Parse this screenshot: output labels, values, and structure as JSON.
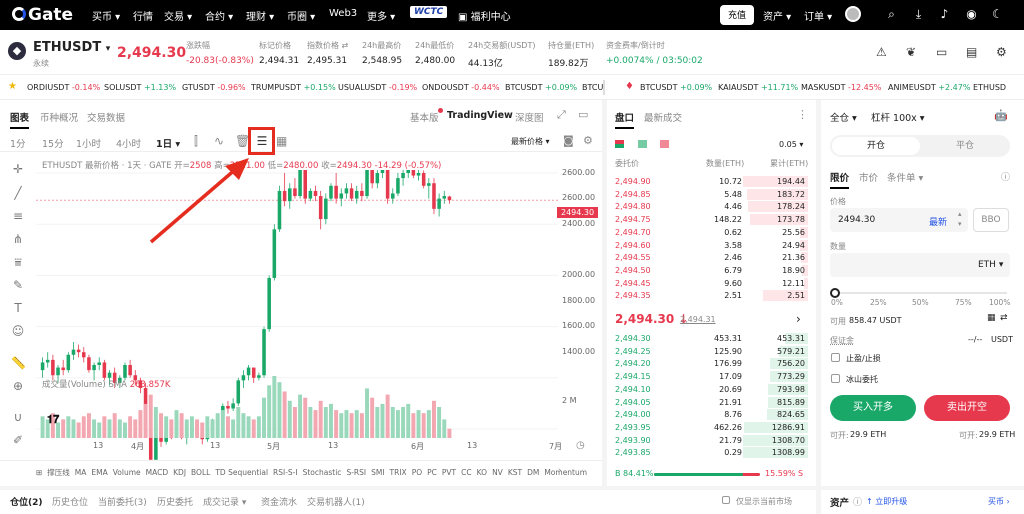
{
  "nav": {
    "logo": "Gate",
    "items": [
      "买币 ▾",
      "行情",
      "交易 ▾",
      "合约 ▾",
      "理财 ▾",
      "币圈 ▾",
      "Web3",
      "更多 ▾"
    ],
    "wctc": "WCTC",
    "welfare": "福利中心",
    "deposit": "充值",
    "assets": "资产 ▾",
    "orders": "订单 ▾"
  },
  "header": {
    "symbol": "ETHUSDT",
    "symbol_caret": "▾",
    "subtitle": "永续",
    "price": "2,494.30",
    "stats": [
      {
        "label": "涨跌幅",
        "value": "-20.83(-0.83%)",
        "color": "red"
      },
      {
        "label": "标记价格",
        "value": "2,494.31",
        "color": ""
      },
      {
        "label": "指数价格 ⇄",
        "value": "2,495.31",
        "color": ""
      },
      {
        "label": "24h最高价",
        "value": "2,548.95",
        "color": ""
      },
      {
        "label": "24h最低价",
        "value": "2,480.00",
        "color": ""
      },
      {
        "label": "24h交易额(USDT)",
        "value": "44.13亿",
        "color": ""
      },
      {
        "label": "持仓量(ETH)",
        "value": "189.82万",
        "color": ""
      },
      {
        "label": "资金费率/倒计时",
        "value": "+0.0074% / 03:50:02",
        "color": "green"
      }
    ]
  },
  "ticker": [
    {
      "sym": "ORDIUSDT",
      "chg": "-0.14%",
      "c": "red"
    },
    {
      "sym": "SOLUSDT",
      "chg": "+1.13%",
      "c": "green"
    },
    {
      "sym": "GTUSDT",
      "chg": "-0.96%",
      "c": "red"
    },
    {
      "sym": "TRUMPUSDT",
      "chg": "+0.15%",
      "c": "green"
    },
    {
      "sym": "USUALUSDT",
      "chg": "-0.19%",
      "c": "red"
    },
    {
      "sym": "ONDOUSDT",
      "chg": "-0.44%",
      "c": "red"
    },
    {
      "sym": "BTCUSDT",
      "chg": "+0.09%",
      "c": "green"
    },
    {
      "sym": "BTCU",
      "chg": "",
      "c": ""
    },
    {
      "sym": "BTCUSDT",
      "chg": "+0.09%",
      "c": "green"
    },
    {
      "sym": "KAIAUSDT",
      "chg": "+11.71%",
      "c": "green"
    },
    {
      "sym": "MASKUSDT",
      "chg": "-12.45%",
      "c": "red"
    },
    {
      "sym": "ANIMEUSDT",
      "chg": "+2.47%",
      "c": "green"
    },
    {
      "sym": "ETHUSD",
      "chg": "",
      "c": ""
    }
  ],
  "chart_tabs": {
    "chart": "图表",
    "overview": "币种概况",
    "trades": "交易数据",
    "basic": "基本版",
    "tv": "TradingView",
    "depth": "深度图"
  },
  "intervals": [
    "1分",
    "15分",
    "1小时",
    "4小时",
    "1日 ▾"
  ],
  "latest_price": "最新价格 ▾",
  "legend": {
    "title": "ETHUSDT 最新价格 · 1天 · GATE",
    "open_l": "开=",
    "open": "2508",
    "high_l": "高=",
    "high": "2511.00",
    "low_l": "低=",
    "low": "2480.00",
    "close_l": "收=",
    "close": "2494.30",
    "chg": "-14.29 (-0.57%)"
  },
  "volume_label": "成交量(Volume) SMA",
  "volume_value": "263.857K",
  "price_tag": "2494.30",
  "chart_data": {
    "type": "candlestick",
    "yticks": [
      "2600.00",
      "2400.00",
      "2200.00",
      "2000.00",
      "1800.00",
      "1600.00",
      "1400.00"
    ],
    "xticks": [
      "13",
      "4月",
      "13",
      "5月",
      "13",
      "6月",
      "13",
      "7月"
    ],
    "vol_tick": "2 M",
    "candles": [
      [
        1830,
        1880,
        1800,
        1860
      ],
      [
        1860,
        1900,
        1840,
        1870
      ],
      [
        1870,
        1890,
        1790,
        1810
      ],
      [
        1810,
        1850,
        1780,
        1840
      ],
      [
        1840,
        1870,
        1810,
        1830
      ],
      [
        1830,
        1900,
        1820,
        1890
      ],
      [
        1890,
        1940,
        1870,
        1910
      ],
      [
        1910,
        1930,
        1880,
        1900
      ],
      [
        1900,
        1920,
        1860,
        1880
      ],
      [
        1880,
        1890,
        1820,
        1830
      ],
      [
        1830,
        1860,
        1790,
        1850
      ],
      [
        1850,
        1880,
        1830,
        1860
      ],
      [
        1860,
        1870,
        1790,
        1800
      ],
      [
        1800,
        1830,
        1770,
        1820
      ],
      [
        1820,
        1840,
        1760,
        1780
      ],
      [
        1780,
        1810,
        1760,
        1800
      ],
      [
        1800,
        1860,
        1790,
        1850
      ],
      [
        1850,
        1870,
        1800,
        1810
      ],
      [
        1810,
        1830,
        1770,
        1790
      ],
      [
        1790,
        1800,
        1740,
        1760
      ],
      [
        1760,
        1780,
        1580,
        1600
      ],
      [
        1600,
        1620,
        1440,
        1480
      ],
      [
        1480,
        1580,
        1470,
        1570
      ],
      [
        1570,
        1600,
        1530,
        1550
      ],
      [
        1550,
        1600,
        1540,
        1590
      ],
      [
        1590,
        1620,
        1560,
        1580
      ],
      [
        1580,
        1660,
        1570,
        1640
      ],
      [
        1640,
        1650,
        1560,
        1570
      ],
      [
        1570,
        1600,
        1540,
        1590
      ],
      [
        1590,
        1630,
        1570,
        1610
      ],
      [
        1610,
        1630,
        1570,
        1580
      ],
      [
        1580,
        1600,
        1540,
        1560
      ],
      [
        1560,
        1610,
        1550,
        1600
      ],
      [
        1600,
        1640,
        1580,
        1620
      ],
      [
        1620,
        1650,
        1600,
        1640
      ],
      [
        1640,
        1700,
        1630,
        1690
      ],
      [
        1690,
        1710,
        1660,
        1680
      ],
      [
        1680,
        1720,
        1670,
        1700
      ],
      [
        1700,
        1800,
        1690,
        1790
      ],
      [
        1790,
        1830,
        1760,
        1810
      ],
      [
        1810,
        1850,
        1790,
        1840
      ],
      [
        1840,
        1840,
        1780,
        1800
      ],
      [
        1800,
        1820,
        1790,
        1810
      ],
      [
        1810,
        2000,
        1800,
        1990
      ],
      [
        1990,
        2200,
        1980,
        2190
      ],
      [
        2190,
        2400,
        2180,
        2380
      ],
      [
        2380,
        2550,
        2370,
        2530
      ],
      [
        2530,
        2600,
        2470,
        2490
      ],
      [
        2490,
        2560,
        2460,
        2540
      ],
      [
        2540,
        2580,
        2500,
        2510
      ],
      [
        2510,
        2640,
        2500,
        2620
      ],
      [
        2620,
        2640,
        2480,
        2500
      ],
      [
        2500,
        2540,
        2490,
        2530
      ],
      [
        2530,
        2550,
        2490,
        2510
      ],
      [
        2510,
        2530,
        2380,
        2420
      ],
      [
        2420,
        2520,
        2400,
        2500
      ],
      [
        2500,
        2560,
        2490,
        2550
      ],
      [
        2550,
        2600,
        2480,
        2500
      ],
      [
        2500,
        2540,
        2470,
        2520
      ],
      [
        2520,
        2560,
        2500,
        2540
      ],
      [
        2540,
        2560,
        2490,
        2500
      ],
      [
        2500,
        2550,
        2480,
        2530
      ],
      [
        2530,
        2560,
        2490,
        2510
      ],
      [
        2510,
        2700,
        2500,
        2680
      ],
      [
        2680,
        2700,
        2540,
        2560
      ],
      [
        2560,
        2620,
        2540,
        2600
      ],
      [
        2600,
        2660,
        2580,
        2640
      ],
      [
        2640,
        2680,
        2480,
        2500
      ],
      [
        2500,
        2540,
        2480,
        2520
      ],
      [
        2520,
        2600,
        2510,
        2580
      ],
      [
        2580,
        2620,
        2550,
        2600
      ],
      [
        2600,
        2650,
        2580,
        2630
      ],
      [
        2630,
        2640,
        2580,
        2590
      ],
      [
        2590,
        2620,
        2570,
        2600
      ],
      [
        2600,
        2610,
        2540,
        2550
      ],
      [
        2550,
        2580,
        2500,
        2560
      ],
      [
        2560,
        2580,
        2440,
        2460
      ],
      [
        2460,
        2520,
        2430,
        2500
      ],
      [
        2500,
        2530,
        2480,
        2510
      ],
      [
        2508,
        2511,
        2480,
        2494
      ]
    ],
    "volumes": [
      0.7,
      0.6,
      0.8,
      0.5,
      0.6,
      0.7,
      0.6,
      0.5,
      0.7,
      0.8,
      0.6,
      0.5,
      0.7,
      0.6,
      0.8,
      0.6,
      0.5,
      0.7,
      0.6,
      0.9,
      1.1,
      1.4,
      1.0,
      0.8,
      0.7,
      0.6,
      0.9,
      0.8,
      0.6,
      0.7,
      0.6,
      0.5,
      0.7,
      0.6,
      0.8,
      0.9,
      0.7,
      0.6,
      1.0,
      0.8,
      0.7,
      0.6,
      0.7,
      1.3,
      1.7,
      2.0,
      1.8,
      1.5,
      1.2,
      1.0,
      1.4,
      1.3,
      1.0,
      0.9,
      1.2,
      1.0,
      1.1,
      0.9,
      0.8,
      0.9,
      0.8,
      0.9,
      0.8,
      1.6,
      1.3,
      1.0,
      1.1,
      1.4,
      1.0,
      0.9,
      1.0,
      1.1,
      0.8,
      0.9,
      0.8,
      0.9,
      1.2,
      1.0,
      0.6,
      0.3
    ]
  },
  "indicators": [
    "撑压线",
    "MA",
    "EMA",
    "Volume",
    "MACD",
    "KDJ",
    "BOLL",
    "TD Sequential",
    "RSI-S-I",
    "Stochastic",
    "S-RSI",
    "SMI",
    "TRIX",
    "PO",
    "PC",
    "PVT",
    "CC",
    "KO",
    "NV",
    "KST",
    "DM",
    "Momentum"
  ],
  "orderbook": {
    "tab1": "盘口",
    "tab2": "最新成交",
    "step": "0.05 ▾",
    "col_price": "委托价",
    "col_qty": "数量(ETH)",
    "col_total": "累计(ETH)",
    "asks": [
      [
        "2,494.90",
        "10.72",
        "194.44"
      ],
      [
        "2,494.85",
        "5.48",
        "183.72"
      ],
      [
        "2,494.80",
        "4.46",
        "178.24"
      ],
      [
        "2,494.75",
        "148.22",
        "173.78"
      ],
      [
        "2,494.70",
        "0.62",
        "25.56"
      ],
      [
        "2,494.60",
        "3.58",
        "24.94"
      ],
      [
        "2,494.55",
        "2.46",
        "21.36"
      ],
      [
        "2,494.50",
        "6.79",
        "18.90"
      ],
      [
        "2,494.45",
        "9.60",
        "12.11"
      ],
      [
        "2,494.35",
        "2.51",
        "2.51"
      ]
    ],
    "ask_depth": [
      1.0,
      0.94,
      0.92,
      0.89,
      0.13,
      0.13,
      0.11,
      0.1,
      0.06,
      0.7
    ],
    "mid_price": "2,494.30 ↓",
    "mid_mark": "2,494.31",
    "mid_arrow": "›",
    "bids": [
      [
        "2,494.30",
        "453.31",
        "453.31"
      ],
      [
        "2,494.25",
        "125.90",
        "579.21"
      ],
      [
        "2,494.20",
        "176.99",
        "756.20"
      ],
      [
        "2,494.15",
        "17.09",
        "773.29"
      ],
      [
        "2,494.10",
        "20.69",
        "793.98"
      ],
      [
        "2,494.05",
        "21.91",
        "815.89"
      ],
      [
        "2,494.00",
        "8.76",
        "824.65"
      ],
      [
        "2,493.95",
        "462.26",
        "1286.91"
      ],
      [
        "2,493.90",
        "21.79",
        "1308.70"
      ],
      [
        "2,493.85",
        "0.29",
        "1308.99"
      ]
    ],
    "bid_depth": [
      0.35,
      0.44,
      0.58,
      0.59,
      0.61,
      0.62,
      0.63,
      0.98,
      1.0,
      1.0
    ],
    "buy_ratio": "B 84.41%",
    "sell_ratio": "15.59% S",
    "buy_fraction": 0.8441
  },
  "trade": {
    "margin_mode": "全仓 ▾",
    "leverage": "杠杆 100x ▾",
    "open": "开仓",
    "close": "平仓",
    "types": [
      "限价",
      "市价",
      "条件单 ▾"
    ],
    "price_label": "价格",
    "price_value": "2494.30",
    "latest": "最新",
    "bbo": "BBO",
    "qty_label": "数量",
    "qty_unit": "ETH ▾",
    "pcts": [
      "0%",
      "25%",
      "50%",
      "75%",
      "100%"
    ],
    "avail_label": "可用",
    "avail_value": "858.47 USDT",
    "margin_label": "保证金",
    "margin_value": "--/--",
    "margin_unit": "USDT",
    "tpsl": "止盈/止损",
    "iceberg": "冰山委托",
    "buy_btn": "买入开多",
    "sell_btn": "卖出开空",
    "can_open_l": "可开:",
    "can_open_buy": "29.9 ETH",
    "can_open_sell": "29.9 ETH"
  },
  "bottom": {
    "tabs": [
      "仓位(2)",
      "历史仓位",
      "当前委托(3)",
      "历史委托",
      "成交记录 ▾",
      "资金流水",
      "交易机器人(1)"
    ],
    "only_current": "仅显示当前市场",
    "assets": "资产",
    "upgrade": "↑ 立即升级",
    "buy_coin": "买币 ›"
  }
}
